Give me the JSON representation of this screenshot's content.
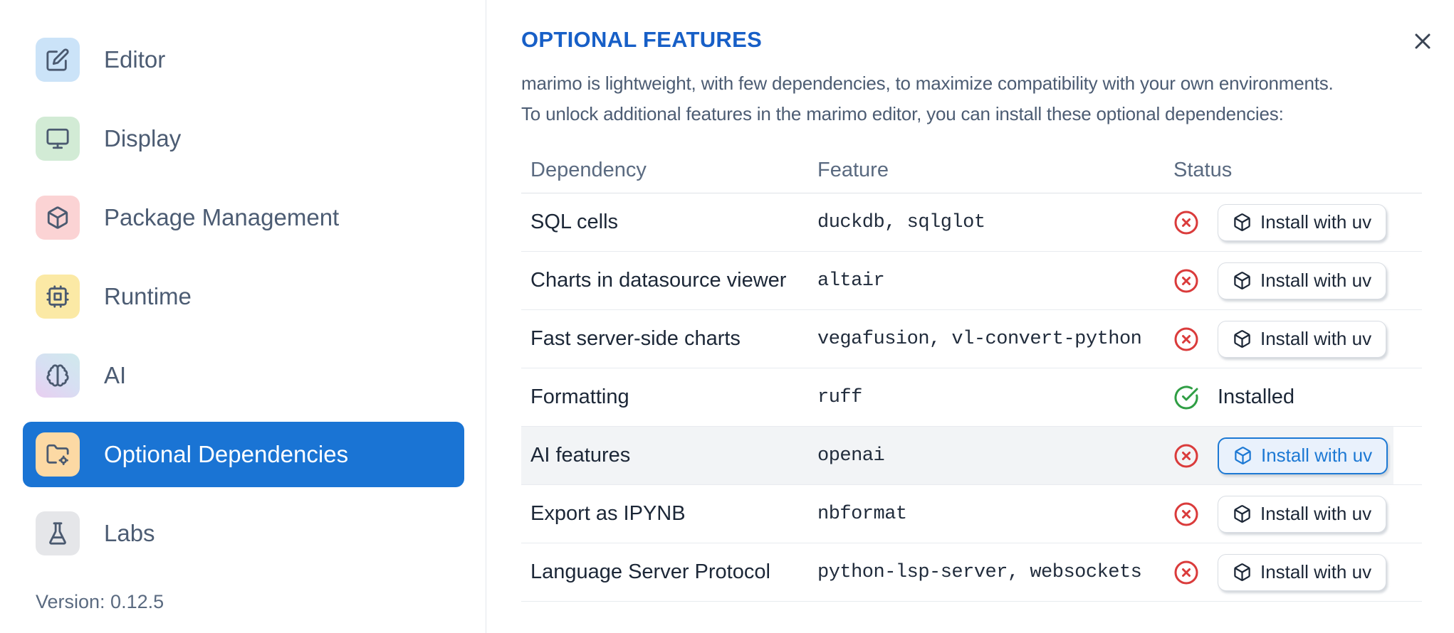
{
  "colors": {
    "accent_blue": "#1a74d4",
    "title_blue": "#175fc7",
    "error_red": "#da3b3b",
    "success_green": "#2f9e44",
    "focus_blue": "#1d79d4",
    "highlight_row_bg": "#f2f4f6"
  },
  "sidebar": {
    "items": [
      {
        "label": "Editor",
        "icon": "edit-icon",
        "tile_colors": [
          "#cbe3f8"
        ],
        "selected": false
      },
      {
        "label": "Display",
        "icon": "monitor-icon",
        "tile_colors": [
          "#d2ebd5"
        ],
        "selected": false
      },
      {
        "label": "Package Management",
        "icon": "package-icon",
        "tile_colors": [
          "#fbd3d4"
        ],
        "selected": false
      },
      {
        "label": "Runtime",
        "icon": "cpu-icon",
        "tile_colors": [
          "#fbe9a5"
        ],
        "selected": false
      },
      {
        "label": "AI",
        "icon": "brain-icon",
        "tile_colors": [
          "#e9cef0",
          "#d7dff3",
          "#cfe9ec"
        ],
        "selected": false
      },
      {
        "label": "Optional Dependencies",
        "icon": "folder-cog-icon",
        "tile_colors": [
          "#fcd9a4"
        ],
        "selected": true
      },
      {
        "label": "Labs",
        "icon": "flask-icon",
        "tile_colors": [
          "#e5e6e9"
        ],
        "selected": false
      }
    ],
    "version_label": "Version: 0.12.5"
  },
  "dialog": {
    "title": "OPTIONAL FEATURES",
    "description_line1": "marimo is lightweight, with few dependencies, to maximize compatibility with your own environments.",
    "description_line2": "To unlock additional features in the marimo editor, you can install these optional dependencies:",
    "close_icon": "close-icon",
    "table": {
      "headers": [
        "Dependency",
        "Feature",
        "Status"
      ],
      "status_icons": {
        "not_installed": "circle-x-icon",
        "installed": "circle-check-icon"
      },
      "install_button_icon": "package-icon",
      "rows": [
        {
          "dependency": "SQL cells",
          "feature": "duckdb, sqlglot",
          "installed": false,
          "action_label": "Install with uv",
          "highlighted": false
        },
        {
          "dependency": "Charts in datasource viewer",
          "feature": "altair",
          "installed": false,
          "action_label": "Install with uv",
          "highlighted": false
        },
        {
          "dependency": "Fast server-side charts",
          "feature": "vegafusion, vl-convert-python",
          "installed": false,
          "action_label": "Install with uv",
          "highlighted": false
        },
        {
          "dependency": "Formatting",
          "feature": "ruff",
          "installed": true,
          "status_label": "Installed",
          "highlighted": false
        },
        {
          "dependency": "AI features",
          "feature": "openai",
          "installed": false,
          "action_label": "Install with uv",
          "highlighted": true
        },
        {
          "dependency": "Export as IPYNB",
          "feature": "nbformat",
          "installed": false,
          "action_label": "Install with uv",
          "highlighted": false
        },
        {
          "dependency": "Language Server Protocol",
          "feature": "python-lsp-server, websockets",
          "installed": false,
          "action_label": "Install with uv",
          "highlighted": false
        }
      ]
    }
  }
}
